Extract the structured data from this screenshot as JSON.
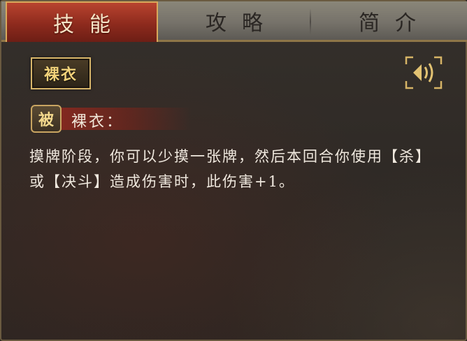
{
  "tabs": {
    "skills": "技能",
    "strategy": "攻略",
    "intro": "简介"
  },
  "badge": "裸衣",
  "sound_icon": "speaker-icon",
  "skill": {
    "type_tag": "被",
    "name": "裸衣：",
    "description": "摸牌阶段，你可以少摸一张牌，然后本回合你使用【杀】或【决斗】造成伤害时，此伤害+1。"
  },
  "colors": {
    "active_tab": "#8d2a1d",
    "gold": "#d8b66a",
    "text": "#efe8de"
  }
}
